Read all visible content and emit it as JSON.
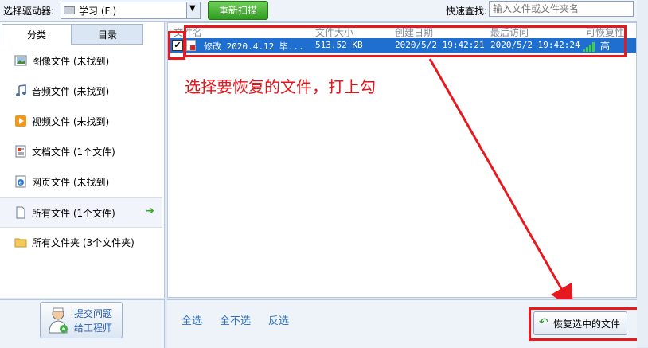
{
  "toolbar": {
    "drive_label": "选择驱动器:",
    "drive_value": "学习 (F:)",
    "rescan_label": "重新扫描",
    "search_label": "快速查找:",
    "search_placeholder": "输入文件或文件夹名"
  },
  "tabs": [
    {
      "label": "分类",
      "active": true
    },
    {
      "label": "目录",
      "active": false
    }
  ],
  "categories": [
    {
      "label": "图像文件 (未找到)",
      "icon": "image-icon"
    },
    {
      "label": "音频文件 (未找到)",
      "icon": "music-note-icon"
    },
    {
      "label": "视频文件 (未找到)",
      "icon": "video-icon"
    },
    {
      "label": "文档文件 (1个文件)",
      "icon": "document-icon"
    },
    {
      "label": "网页文件 (未找到)",
      "icon": "web-page-icon"
    },
    {
      "label": "所有文件 (1个文件)",
      "icon": "file-icon",
      "active": true
    },
    {
      "label": "所有文件夹 (3个文件夹)",
      "icon": "folder-icon"
    }
  ],
  "submit": {
    "line1": "提交问题",
    "line2": "给工程师"
  },
  "columns": [
    "文件名",
    "文件大小",
    "创建日期",
    "最后访问",
    "可恢复性"
  ],
  "rows": [
    {
      "checked": true,
      "name": "修改 2020.4.12 毕...",
      "size": "513.52 KB",
      "created": "2020/5/2 19:42:21",
      "accessed": "2020/5/2 19:42:24",
      "recoverability": "高"
    }
  ],
  "annotation": "选择要恢复的文件，打上勾",
  "footer": {
    "select_all": "全选",
    "select_none": "全不选",
    "invert": "反选",
    "recover_button": "恢复选中的文件"
  },
  "colors": {
    "annotation": "#e8191e",
    "selection": "#1f6fd0",
    "link": "#2a6fc0"
  }
}
